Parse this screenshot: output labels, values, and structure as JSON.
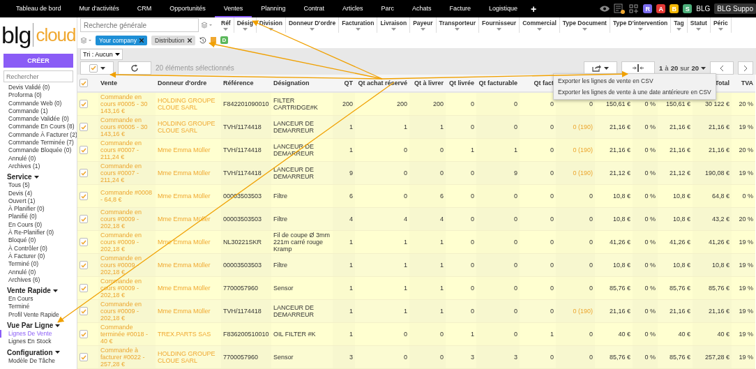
{
  "nav": {
    "items": [
      {
        "label": "Tableau de bord",
        "selected": false
      },
      {
        "label": "Mur d'activités",
        "selected": false
      },
      {
        "label": "CRM",
        "selected": false
      },
      {
        "label": "Opportunités",
        "selected": false
      },
      {
        "label": "Ventes",
        "selected": true
      },
      {
        "label": "Planning",
        "selected": false
      },
      {
        "label": "Contrat",
        "selected": false
      },
      {
        "label": "Articles",
        "selected": false
      },
      {
        "label": "Parc",
        "selected": false
      },
      {
        "label": "Achats",
        "selected": false
      },
      {
        "label": "Facture",
        "selected": false
      },
      {
        "label": "Logistique",
        "selected": false
      }
    ],
    "add": "+",
    "badges": [
      {
        "label": "R",
        "color": "#7b6cf0"
      },
      {
        "label": "A",
        "color": "#e53935"
      },
      {
        "label": "B",
        "color": "#f2b705"
      },
      {
        "label": "S",
        "color": "#4caf7a"
      }
    ],
    "user": "BLG",
    "account": "BLG Suppo"
  },
  "logo": {
    "left": "blg",
    "right": "cloud"
  },
  "search": {
    "placeholder": "Recherche générale"
  },
  "filters": [
    "Réf",
    "Désig",
    "Division",
    "Donneur D'ordre",
    "Facturation",
    "Livraison",
    "Payeur",
    "Transporteur",
    "Fournisseur",
    "Commercial",
    "Type Document",
    "Type D'intervention",
    "Tag",
    "Statut",
    "Péric"
  ],
  "chips": [
    {
      "label": "Your company",
      "color": "#1e8fd6"
    },
    {
      "label": "Distribution",
      "color": "#dddddd"
    }
  ],
  "badge_d": "D",
  "sort": "Tri : Aucun",
  "sidebar": {
    "create": "CRÉER",
    "search_placeholder": "Rechercher",
    "sections": [
      {
        "items": [
          {
            "label": "Devis Validé (0)",
            "selected": false
          },
          {
            "label": "Proforma (0)",
            "selected": false
          },
          {
            "label": "Commande Web (0)",
            "selected": false
          },
          {
            "label": "Commande (1)",
            "selected": false
          },
          {
            "label": "Commande Validée (0)",
            "selected": false
          },
          {
            "label": "Commande En Cours (8)",
            "selected": false
          },
          {
            "label": "Commande À Facturer (2)",
            "selected": false
          },
          {
            "label": "Commande Terminée (7)",
            "selected": false
          },
          {
            "label": "Commande Bloquée (0)",
            "selected": false
          },
          {
            "label": "Annulé (0)",
            "selected": false
          },
          {
            "label": "Archives (1)",
            "selected": false
          }
        ]
      },
      {
        "title": "Service",
        "items": [
          {
            "label": "Tous (5)",
            "selected": false
          },
          {
            "label": "Devis (4)",
            "selected": false
          },
          {
            "label": "Ouvert (1)",
            "selected": false
          },
          {
            "label": "À Planifier (0)",
            "selected": false
          },
          {
            "label": "Planifié (0)",
            "selected": false
          },
          {
            "label": "En Cours (0)",
            "selected": false
          },
          {
            "label": "À Re-Planifier (0)",
            "selected": false
          },
          {
            "label": "Bloqué (0)",
            "selected": false
          },
          {
            "label": "À Contrôler (0)",
            "selected": false
          },
          {
            "label": "À Facturer (0)",
            "selected": false
          },
          {
            "label": "Terminé (0)",
            "selected": false
          },
          {
            "label": "Annulé (0)",
            "selected": false
          },
          {
            "label": "Archives (6)",
            "selected": false
          }
        ]
      },
      {
        "title": "Vente Rapide",
        "items": [
          {
            "label": "En Cours",
            "selected": false
          },
          {
            "label": "Terminé",
            "selected": false
          },
          {
            "label": "Profil Vente Rapide",
            "selected": false
          }
        ]
      },
      {
        "title": "Vue Par Ligne",
        "items": [
          {
            "label": "Lignes De Vente",
            "selected": true
          },
          {
            "label": "Lignes En Stock",
            "selected": false
          }
        ]
      },
      {
        "title": "Configuration",
        "items": [
          {
            "label": "Modèle De Tâche",
            "selected": false
          }
        ]
      }
    ]
  },
  "toolbar": {
    "selection": "20 éléments sélectionnés",
    "pager": "**1** à **20** sur **20**"
  },
  "export_menu": [
    "Exporter les lignes de vente en CSV",
    "Exporter les lignes de vente à une date antérieure en CSV"
  ],
  "table": {
    "all_checked": true,
    "columns": [
      {
        "label": "Vente",
        "kind": "link"
      },
      {
        "label": "Donneur d'ordre",
        "kind": "link"
      },
      {
        "label": "Référence",
        "kind": "text"
      },
      {
        "label": "Désignation",
        "kind": "text"
      },
      {
        "label": "QT",
        "kind": "number"
      },
      {
        "label": "Qt achat réservé",
        "kind": "number"
      },
      {
        "label": "Qt à livrer",
        "kind": "number"
      },
      {
        "label": "Qt livrée",
        "kind": "number"
      },
      {
        "label": "Qt facturable",
        "kind": "number"
      },
      {
        "label": "Qt fact",
        "kind": "number"
      },
      {
        "kind": "stock"
      },
      {
        "kind": "number"
      },
      {
        "kind": "number"
      },
      {
        "kind": "number"
      },
      {
        "label": "Total",
        "kind": "number"
      },
      {
        "label": "TVA",
        "kind": "number"
      }
    ],
    "rows": [
      {
        "checked": true,
        "stock_alert": false,
        "cells": [
          "Commande en cours #0005 - 30 143,16 €",
          "HOLDING GROUPE CLOUE SARL",
          "F842201090010",
          "FILTER CARTRIDGE#K",
          "200",
          "200",
          "200",
          "0",
          "0",
          "0",
          "0",
          "150,61 €",
          "0 %",
          "150,61 €",
          "30 122 €",
          "20 %"
        ]
      },
      {
        "checked": true,
        "stock_alert": true,
        "cells": [
          "Commande en cours #0005 - 30 143,16 €",
          "HOLDING GROUPE CLOUE SARL",
          "TVH/1174418",
          "LANCEUR DE DEMARREUR",
          "1",
          "1",
          "1",
          "0",
          "0",
          "0",
          "0 (190)",
          "21,16 €",
          "0 %",
          "21,16 €",
          "21,16 €",
          "19 %"
        ]
      },
      {
        "checked": true,
        "stock_alert": true,
        "cells": [
          "Commande en cours #0007 - 211,24 €",
          "Mme Emma Müller",
          "TVH/1174418",
          "LANCEUR DE DEMARREUR",
          "1",
          "0",
          "0",
          "1",
          "1",
          "0",
          "0 (190)",
          "21,16 €",
          "0 %",
          "21,16 €",
          "21,16 €",
          "20 %"
        ]
      },
      {
        "checked": true,
        "stock_alert": true,
        "cells": [
          "Commande en cours #0007 - 211,24 €",
          "Mme Emma Müller",
          "TVH/1174418",
          "LANCEUR DE DEMARREUR",
          "9",
          "0",
          "0",
          "0",
          "9",
          "0",
          "0 (190)",
          "21,12 €",
          "0 %",
          "21,12 €",
          "190,08 €",
          "19 %"
        ]
      },
      {
        "checked": true,
        "stock_alert": false,
        "cells": [
          "Commande #0008 - 64,8 €",
          "Mme Emma Müller",
          "00003503503",
          "Filtre",
          "6",
          "0",
          "6",
          "0",
          "0",
          "0",
          "0",
          "10,8 €",
          "0 %",
          "10,8 €",
          "64,8 €",
          "0 %"
        ]
      },
      {
        "checked": true,
        "stock_alert": false,
        "cells": [
          "Commande en cours #0009 - 202,18 €",
          "Mme Emma Müller",
          "00003503503",
          "Filtre",
          "4",
          "4",
          "4",
          "0",
          "0",
          "0",
          "0",
          "10,8 €",
          "0 %",
          "10,8 €",
          "43,2 €",
          "20 %"
        ]
      },
      {
        "checked": true,
        "stock_alert": false,
        "cells": [
          "Commande en cours #0009 - 202,18 €",
          "Mme Emma Müller",
          "NL30221SKR",
          "Fil de coupe Ø 3mm 221m carré rouge Kramp",
          "1",
          "1",
          "1",
          "0",
          "0",
          "0",
          "0",
          "41,26 €",
          "0 %",
          "41,26 €",
          "41,26 €",
          "19 %"
        ]
      },
      {
        "checked": true,
        "stock_alert": false,
        "cells": [
          "Commande en cours #0009 - 202,18 €",
          "Mme Emma Müller",
          "00003503503",
          "Filtre",
          "1",
          "1",
          "1",
          "0",
          "0",
          "0",
          "0",
          "10,8 €",
          "0 %",
          "10,8 €",
          "10,8 €",
          "19 %"
        ]
      },
      {
        "checked": true,
        "stock_alert": false,
        "cells": [
          "Commande en cours #0009 - 202,18 €",
          "Mme Emma Müller",
          "7700057960",
          "Sensor",
          "1",
          "1",
          "1",
          "0",
          "0",
          "0",
          "0",
          "85,76 €",
          "0 %",
          "85,76 €",
          "85,76 €",
          "19 %"
        ]
      },
      {
        "checked": true,
        "stock_alert": true,
        "cells": [
          "Commande en cours #0009 - 202,18 €",
          "Mme Emma Müller",
          "TVH/1174418",
          "LANCEUR DE DEMARREUR",
          "1",
          "1",
          "1",
          "0",
          "0",
          "0",
          "0 (190)",
          "21,16 €",
          "0 %",
          "21,16 €",
          "21,16 €",
          "19 %"
        ]
      },
      {
        "checked": true,
        "stock_alert": false,
        "cells": [
          "Commande terminée #0018 - 40 €",
          "TREX.PARTS SAS",
          "F836200510010",
          "OIL FILTER #K",
          "1",
          "0",
          "0",
          "1",
          "0",
          "1",
          "0",
          "40 €",
          "0 %",
          "40 €",
          "40 €",
          "19 %"
        ]
      },
      {
        "checked": true,
        "stock_alert": false,
        "cells": [
          "Commande à facturer #0022 - 257,28 €",
          "HOLDING GROUPE CLOUE SARL",
          "7700057960",
          "Sensor",
          "3",
          "0",
          "0",
          "3",
          "3",
          "0",
          "0",
          "85,76 €",
          "0 %",
          "85,76 €",
          "257,28 €",
          "19 %"
        ]
      }
    ]
  }
}
